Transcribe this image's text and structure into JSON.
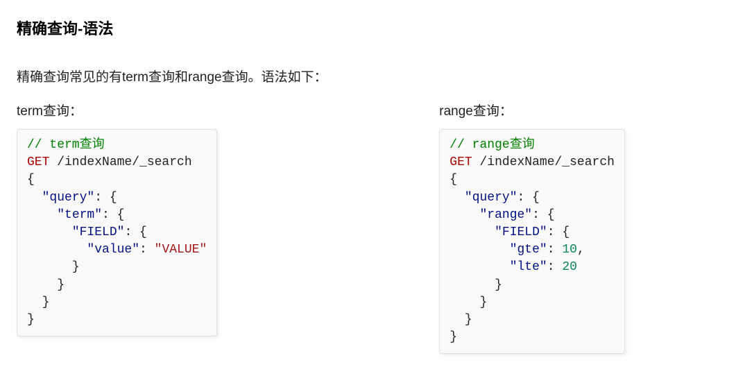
{
  "heading": "精确查询-语法",
  "intro": "精确查询常见的有term查询和range查询。语法如下：",
  "left": {
    "label": "term查询：",
    "code": {
      "comment": "// term查询",
      "method": "GET",
      "path": " /indexName/_search",
      "l1": "{",
      "l2a": "  ",
      "l2k": "\"query\"",
      "l2b": ": {",
      "l3a": "    ",
      "l3k": "\"term\"",
      "l3b": ": {",
      "l4a": "      ",
      "l4k": "\"FIELD\"",
      "l4b": ": {",
      "l5a": "        ",
      "l5k": "\"value\"",
      "l5b": ": ",
      "l5v": "\"VALUE\"",
      "l6": "      }",
      "l7": "    }",
      "l8": "  }",
      "l9": "}"
    }
  },
  "right": {
    "label": "range查询：",
    "code": {
      "comment": "// range查询",
      "method": "GET",
      "path": " /indexName/_search",
      "l1": "{",
      "l2a": "  ",
      "l2k": "\"query\"",
      "l2b": ": {",
      "l3a": "    ",
      "l3k": "\"range\"",
      "l3b": ": {",
      "l4a": "      ",
      "l4k": "\"FIELD\"",
      "l4b": ": {",
      "l5a": "        ",
      "l5k": "\"gte\"",
      "l5b": ": ",
      "l5v": "10",
      "l5c": ",",
      "l6a": "        ",
      "l6k": "\"lte\"",
      "l6b": ": ",
      "l6v": "20",
      "l7": "      }",
      "l8": "    }",
      "l9": "  }",
      "l10": "}"
    }
  }
}
